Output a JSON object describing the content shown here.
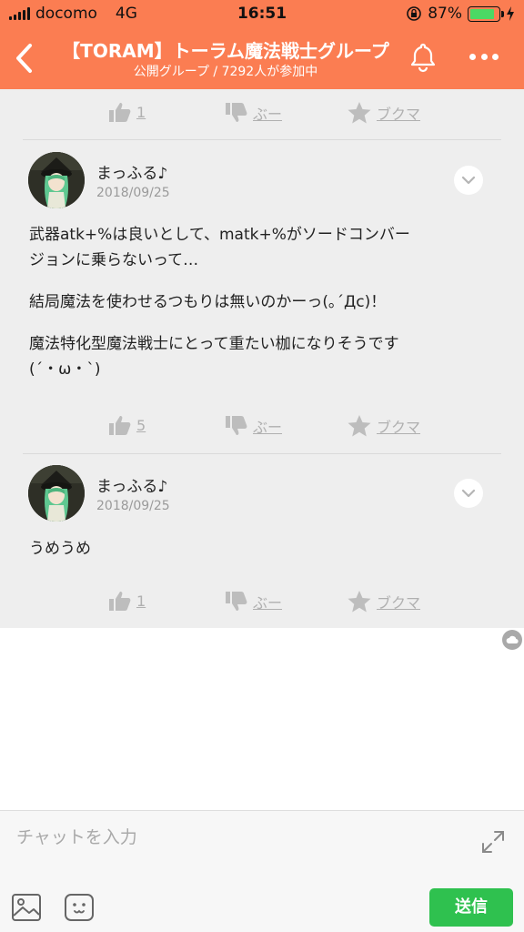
{
  "status": {
    "carrier": "docomo",
    "network": "4G",
    "time": "16:51",
    "battery_text": "87%",
    "battery_level": 0.87,
    "battery_color": "#4cd964"
  },
  "header": {
    "title": "【TORAM】トーラム魔法戦士グループ",
    "subtitle": "公開グループ / 7292人が参加中",
    "background": "#fb7d52",
    "icons": [
      "back-arrow-icon",
      "bell-icon",
      "more-icon"
    ]
  },
  "labels": {
    "dislike": "ぶー",
    "bookmark": "ブクマ"
  },
  "top_actions": {
    "likes": "1"
  },
  "posts": [
    {
      "author": "まっふる♪",
      "date": "2018/09/25",
      "lines": [
        "武器atk+%は良いとして、matk+%がソードコンバー",
        "ジョンに乗らないって…",
        "",
        "結局魔法を使わせるつもりは無いのかーっ(｡´Дc)！",
        "",
        "魔法特化型魔法戦士にとって重たい枷になりそうです",
        "(´・ω・`)"
      ],
      "likes": "5"
    },
    {
      "author": "まっふる♪",
      "date": "2018/09/25",
      "lines": [
        "うめうめ"
      ],
      "likes": "1"
    }
  ],
  "composer": {
    "placeholder": "チャットを入力",
    "send_label": "送信",
    "send_color": "#2fc14f"
  }
}
